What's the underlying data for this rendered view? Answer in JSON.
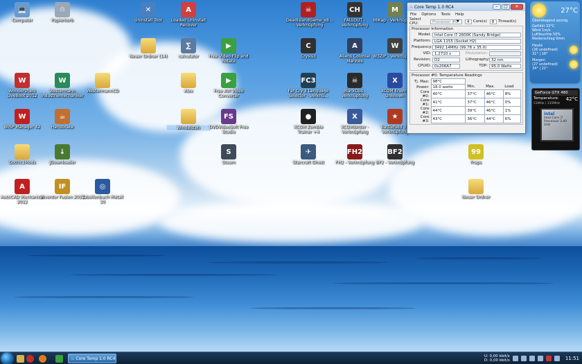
{
  "desktop": {
    "icons": [
      {
        "label": "Computer",
        "glyph": "💻",
        "color": "#6a9ad0"
      },
      {
        "label": "Papierkorb",
        "glyph": "♲",
        "color": "#9aa8b8"
      },
      {
        "label": "Uninstall Tool",
        "glyph": "✕",
        "color": "#4a7fc0"
      },
      {
        "label": "Loaded Uninstall Recover",
        "glyph": "A",
        "color": "#d04040"
      },
      {
        "label": "DeadIslandGame_x8... - Verknüpfung",
        "glyph": "☠",
        "color": "#b02020"
      },
      {
        "label": "FALLOUT - Verknüpfung",
        "glyph": "CH",
        "color": "#333333"
      },
      {
        "label": "MiKap - Verknüpfung",
        "glyph": "M",
        "color": "#708050"
      },
      {
        "label": "Neuer Ordner (14)",
        "glyph": "",
        "color": "folder"
      },
      {
        "label": "calculator",
        "glyph": "∑",
        "color": "#5a7aa0"
      },
      {
        "label": "Free Video Flip and Rotate",
        "glyph": "▶",
        "color": "#3aa040"
      },
      {
        "label": "Crysis3",
        "glyph": "C",
        "color": "#303030"
      },
      {
        "label": "Aliens Colonial Marines",
        "glyph": "A",
        "color": "#304060"
      },
      {
        "label": "W3ZIP - Verknüpfung",
        "glyph": "W",
        "color": "#404040"
      },
      {
        "label": "Wondershare LiveBoot 2012",
        "glyph": "W",
        "color": "#c03030"
      },
      {
        "label": "Westermann Industriemechaniker",
        "glyph": "W",
        "color": "#2a8a5a"
      },
      {
        "label": "WestermannCD",
        "glyph": "",
        "color": "folder"
      },
      {
        "label": "Alex",
        "glyph": "",
        "color": "folder"
      },
      {
        "label": "Free AVI Video Converter",
        "glyph": "▶",
        "color": "#3aa040"
      },
      {
        "label": "Far Cry 3 Language Selector - Verknü...",
        "glyph": "FC3",
        "color": "#204050"
      },
      {
        "label": "BlackOps - Verknüpfung",
        "glyph": "☠",
        "color": "#2a2a2a"
      },
      {
        "label": "XCOM Enemy Unknown",
        "glyph": "X",
        "color": "#2a4aa0"
      },
      {
        "label": "Windelsteh",
        "glyph": "",
        "color": "folder"
      },
      {
        "label": "DVDVideoSoft Free Studio",
        "glyph": "FS",
        "color": "#6a3a8a"
      },
      {
        "label": "WiSP Manager 42",
        "glyph": "W",
        "color": "#c02020"
      },
      {
        "label": "Handbrake",
        "glyph": "☕",
        "color": "#c07030"
      },
      {
        "label": "XCOM Zombie Trainer +4",
        "glyph": "●",
        "color": "#202020"
      },
      {
        "label": "XCOMWriter - Verknüpfung",
        "glyph": "X",
        "color": "#3a5a9a"
      },
      {
        "label": "Battlefield 3 - Verknüpfung",
        "glyph": "★",
        "color": "#b03a20"
      },
      {
        "label": "Gothic3Mods",
        "glyph": "",
        "color": "folder"
      },
      {
        "label": "JDownloader",
        "glyph": "↓",
        "color": "#4a7a30"
      },
      {
        "label": "Steam",
        "glyph": "S",
        "color": "#404a58"
      },
      {
        "label": "Starcraft Ghost",
        "glyph": "✈",
        "color": "#3a5a80"
      },
      {
        "label": "FH2 - Verknüpfung",
        "glyph": "FH2",
        "color": "#8a1a1a"
      },
      {
        "label": "BF2 - Verknüpfung",
        "glyph": "BF2",
        "color": "#303030"
      },
      {
        "label": "Fraps",
        "glyph": "99",
        "color": "#d0c020"
      },
      {
        "label": "AutoCAD Mechanical 2012",
        "glyph": "A",
        "color": "#c02020"
      },
      {
        "label": "Inventor Fusion 2012",
        "glyph": "IF",
        "color": "#c09020"
      },
      {
        "label": "Tabellenbuch Metall 10",
        "glyph": "◎",
        "color": "#2a5aa0"
      },
      {
        "label": "Neuer Ordner",
        "glyph": "",
        "color": "folder"
      }
    ]
  },
  "coretemp": {
    "title": "Core Temp 1.0 RC4",
    "menu": [
      "File",
      "Options",
      "Tools",
      "Help"
    ],
    "select_cpu_label": "Select CPU:",
    "select_cpu_value": "Processor #0",
    "cores_value": "4",
    "cores_label": "Core(s)",
    "threads_value": "8",
    "threads_label": "Thread(s)",
    "proc_info_title": "Processor Information",
    "model_label": "Model:",
    "model_value": "Intel Core i7 2600K (Sandy Bridge)",
    "platform_label": "Platform:",
    "platform_value": "LGA 1155 (Socket H2)",
    "frequency_label": "Frequency:",
    "frequency_value": "3492.14MHz (99.78 x 35.0)",
    "vid_label": "VID:",
    "vid_value": "1.2710 v",
    "modulation_label": "Modulation:",
    "revision_label": "Revision:",
    "revision_value": "D2",
    "lithography_label": "Lithography:",
    "lithography_value": "32 nm",
    "cpuid_label": "CPUID:",
    "cpuid_value": "0x206A7",
    "tdp_label": "TDP:",
    "tdp_value": "95.0 Watts",
    "temp_title": "Processor #0: Temperature Readings",
    "tjmax_label": "Tj. Max:",
    "tjmax_value": "98°C",
    "power_label": "Power:",
    "power_value": "18.0 watts",
    "col_min": "Min.",
    "col_max": "Max.",
    "col_load": "Load",
    "cores": [
      {
        "name": "Core #0:",
        "temp": "40°C",
        "min": "37°C",
        "max": "46°C",
        "load": "8%"
      },
      {
        "name": "Core #1:",
        "temp": "41°C",
        "min": "37°C",
        "max": "46°C",
        "load": "0%"
      },
      {
        "name": "Core #2:",
        "temp": "44°C",
        "min": "39°C",
        "max": "46°C",
        "load": "1%"
      },
      {
        "name": "Core #3:",
        "temp": "43°C",
        "min": "36°C",
        "max": "44°C",
        "load": "6%"
      }
    ]
  },
  "weather": {
    "temp": "27°C",
    "condition": "Überwiegend sonnig",
    "details": [
      "Gefühlt 33°C",
      "Wind 1m/s",
      "Luftfeuchte 50%",
      "Niederschlag 0mm"
    ],
    "day1_name": "Heute",
    "day1_cond": "(26 undefined)",
    "day1_temp": "31° | 18°",
    "day2_name": "Morgen",
    "day2_cond": "(27 undefined)",
    "day2_temp": "34° | 21°"
  },
  "gpu": {
    "name": "GeForce GTX 480",
    "temp_label": "Temperature:",
    "temp_value": "42°C",
    "clock": "51MHz / 135MHz",
    "cpu_brand": "intel",
    "cpu_text": "Intel Core i7 Processor 3.40 GHz"
  },
  "taskbar": {
    "task_label": "Core Temp 1.0 RC4",
    "net_up": "U: 0,00 kbit/s",
    "net_down": "D: 0,00 kbit/s",
    "clock": "11:51"
  }
}
